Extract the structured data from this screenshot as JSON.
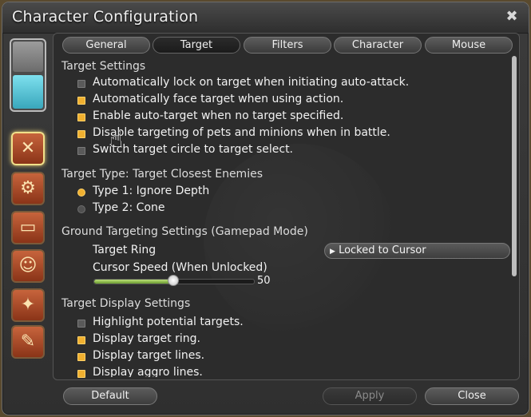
{
  "window": {
    "title": "Character Configuration"
  },
  "tabs": [
    {
      "label": "General"
    },
    {
      "label": "Target",
      "active": true
    },
    {
      "label": "Filters"
    },
    {
      "label": "Character"
    },
    {
      "label": "Mouse"
    }
  ],
  "sections": {
    "target_settings": {
      "header": "Target Settings",
      "options": [
        {
          "label": "Automatically lock on target when initiating auto-attack.",
          "checked": false
        },
        {
          "label": "Automatically face target when using action.",
          "checked": true
        },
        {
          "label": "Enable auto-target when no target specified.",
          "checked": true
        },
        {
          "label": "Disable targeting of pets and minions when in battle.",
          "checked": true
        },
        {
          "label": "Switch target circle to target select.",
          "checked": false
        }
      ]
    },
    "target_type": {
      "header": "Target Type: Target Closest Enemies",
      "options": [
        {
          "label": "Type 1: Ignore Depth",
          "selected": true
        },
        {
          "label": "Type 2: Cone",
          "selected": false
        }
      ]
    },
    "ground_targeting": {
      "header": "Ground Targeting Settings (Gamepad Mode)",
      "target_ring_label": "Target Ring",
      "target_ring_value": "Locked to Cursor",
      "cursor_speed_label": "Cursor Speed (When Unlocked)",
      "cursor_speed_value": "50",
      "cursor_speed_fraction": 0.5
    },
    "display": {
      "header": "Target Display Settings",
      "options": [
        {
          "label": "Highlight potential targets.",
          "checked": false
        },
        {
          "label": "Display target ring.",
          "checked": true
        },
        {
          "label": "Display target lines.",
          "checked": true
        },
        {
          "label": "Display aggro lines.",
          "checked": true
        }
      ]
    }
  },
  "footer": {
    "default_label": "Default",
    "apply_label": "Apply",
    "close_label": "Close"
  },
  "icons": {
    "close": "close-icon",
    "dropdown_arrow": "triangle-right-icon",
    "cursor": "hand-cursor-icon"
  },
  "colors": {
    "checked": "#f0b030",
    "unchecked": "#5a5a5a",
    "slider_fill": "#8fbf3f"
  }
}
